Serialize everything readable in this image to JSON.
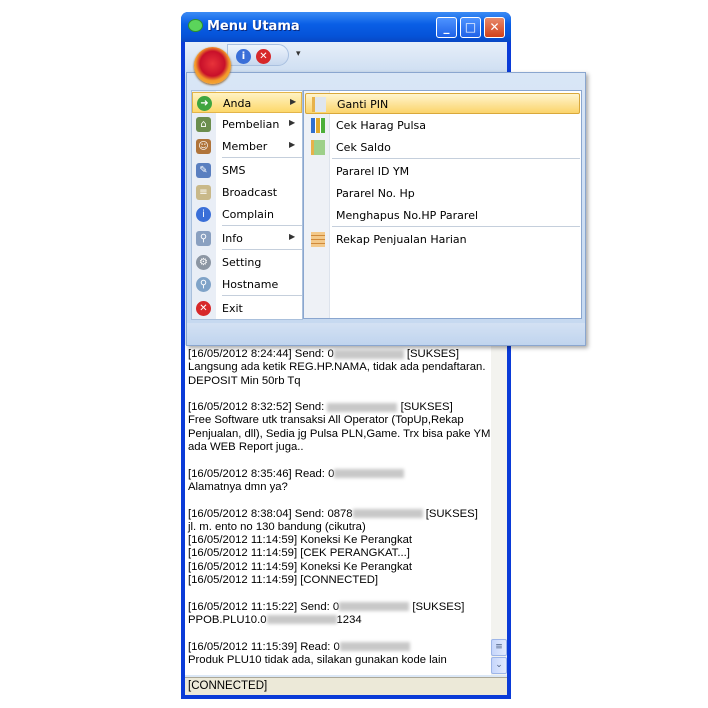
{
  "window": {
    "title": "Menu Utama",
    "min": "_",
    "max": "□",
    "close": "✕"
  },
  "qat": {
    "info_icon": "info-icon",
    "close_icon": "close-icon",
    "more": "▾"
  },
  "menu": {
    "items": [
      {
        "label": "Anda",
        "icon": "arrow-right-circle-icon",
        "submenu": true
      },
      {
        "label": "Pembelian",
        "icon": "house-icon",
        "submenu": true
      },
      {
        "label": "Member",
        "icon": "contact-book-icon",
        "submenu": true
      },
      {
        "label": "SMS",
        "icon": "edit-note-icon",
        "submenu": false
      },
      {
        "label": "Broadcast",
        "icon": "document-icon",
        "submenu": false
      },
      {
        "label": "Complain",
        "icon": "info-icon",
        "submenu": false
      },
      {
        "label": "Info",
        "icon": "search-document-icon",
        "submenu": true
      },
      {
        "label": "Setting",
        "icon": "gear-icon",
        "submenu": false
      },
      {
        "label": "Hostname",
        "icon": "magnifier-cursor-icon",
        "submenu": false
      },
      {
        "label": "Exit",
        "icon": "exit-icon",
        "submenu": false
      }
    ],
    "submenu": [
      {
        "label": "Ganti PIN",
        "icon": "edit-document-icon"
      },
      {
        "label": "Cek Harag Pulsa",
        "icon": "bar-chart-icon"
      },
      {
        "label": "Cek Saldo",
        "icon": "document-arrow-icon"
      },
      {
        "label": "Pararel ID YM"
      },
      {
        "label": "Pararel No. Hp"
      },
      {
        "label": "Menghapus No.HP Pararel"
      },
      {
        "label": "Rekap Penjualan Harian",
        "icon": "table-icon"
      }
    ]
  },
  "log": [
    {
      "a": "[16/05/2012 8:24:44] Send: 0",
      "r": true,
      "b": " [SUKSES]"
    },
    {
      "a": "Langsung ada ketik REG.HP.NAMA, tidak ada pendaftaran."
    },
    {
      "a": "DEPOSIT Min 50rb Tq"
    },
    {
      "a": ""
    },
    {
      "a": "[16/05/2012 8:32:52] Send: ",
      "r": true,
      "b": " [SUKSES]"
    },
    {
      "a": "Free Software utk transaksi All Operator (TopUp,Rekap"
    },
    {
      "a": "Penjualan, dll), Sedia jg Pulsa PLN,Game. Trx bisa pake YM"
    },
    {
      "a": "ada WEB Report juga.."
    },
    {
      "a": ""
    },
    {
      "a": "[16/05/2012 8:35:46] Read: 0",
      "r": true
    },
    {
      "a": "Alamatnya dmn ya?"
    },
    {
      "a": ""
    },
    {
      "a": "[16/05/2012 8:38:04] Send: 0878",
      "r": true,
      "b": " [SUKSES]"
    },
    {
      "a": "jl. m. ento no 130 bandung (cikutra)"
    },
    {
      "a": "[16/05/2012 11:14:59] Koneksi Ke Perangkat"
    },
    {
      "a": "[16/05/2012 11:14:59] [CEK PERANGKAT...]"
    },
    {
      "a": "[16/05/2012 11:14:59] Koneksi Ke Perangkat"
    },
    {
      "a": "[16/05/2012 11:14:59] [CONNECTED]"
    },
    {
      "a": ""
    },
    {
      "a": "[16/05/2012 11:15:22] Send: 0",
      "r": true,
      "b": " [SUKSES]"
    },
    {
      "a": "PPOB.PLU10.0",
      "r": true,
      "b": "1234"
    },
    {
      "a": ""
    },
    {
      "a": "[16/05/2012 11:15:39] Read: 0",
      "r": true
    },
    {
      "a": "Produk PLU10 tidak ada, silakan gunakan kode lain"
    }
  ],
  "status": "[CONNECTED]",
  "scrollbar": {
    "grip": "≡",
    "down": "⌄"
  }
}
